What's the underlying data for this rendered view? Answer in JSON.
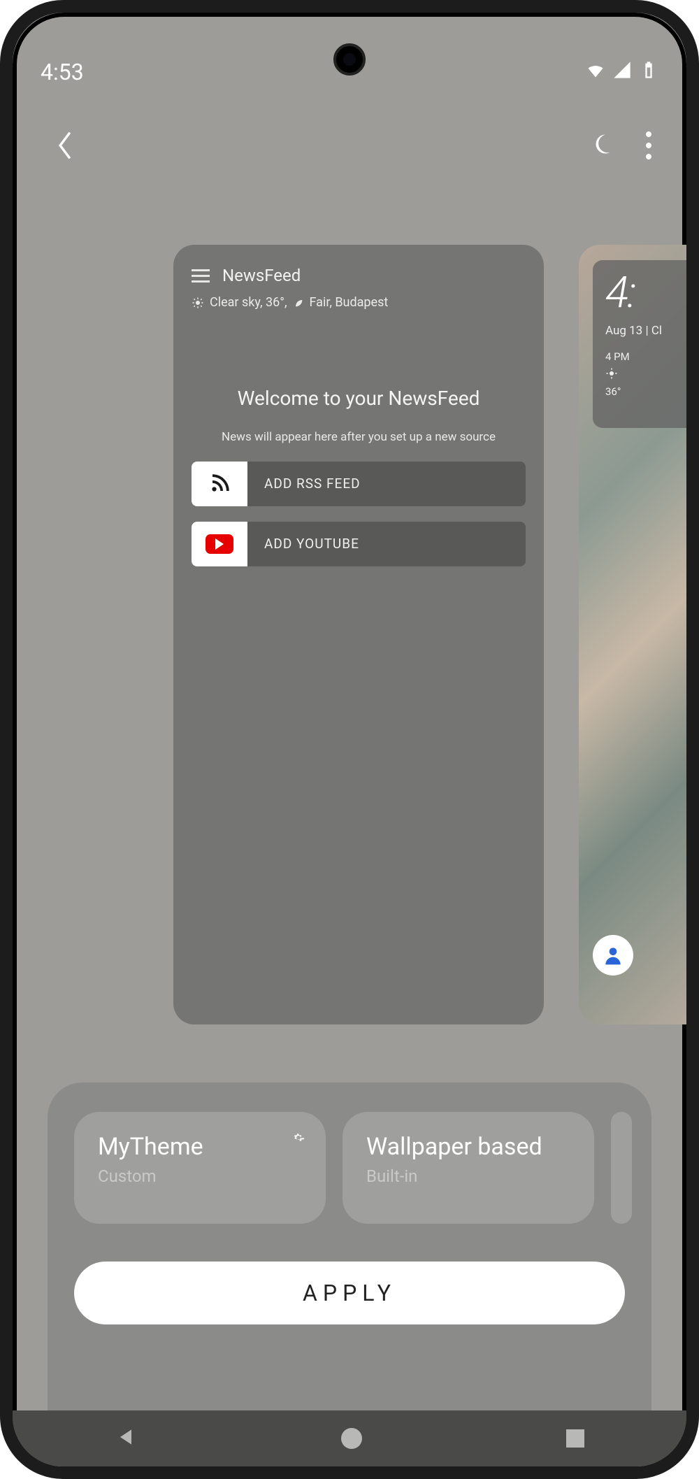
{
  "status": {
    "time": "4:53"
  },
  "newsfeed": {
    "title": "NewsFeed",
    "weather": "Clear sky, 36°,",
    "weather_suffix": "Fair, Budapest",
    "welcome": "Welcome to your NewsFeed",
    "subtitle": "News will appear here after you set up a new source",
    "buttons": [
      {
        "label": "ADD RSS FEED"
      },
      {
        "label": "ADD YOUTUBE"
      }
    ]
  },
  "peek": {
    "time": "4:",
    "date": "Aug 13 | Cl",
    "hour": "4 PM",
    "temp": "36°"
  },
  "themes": [
    {
      "name": "MyTheme",
      "sub": "Custom",
      "has_gear": true
    },
    {
      "name": "Wallpaper based",
      "sub": "Built-in",
      "has_gear": false
    }
  ],
  "apply_label": "APPLY"
}
